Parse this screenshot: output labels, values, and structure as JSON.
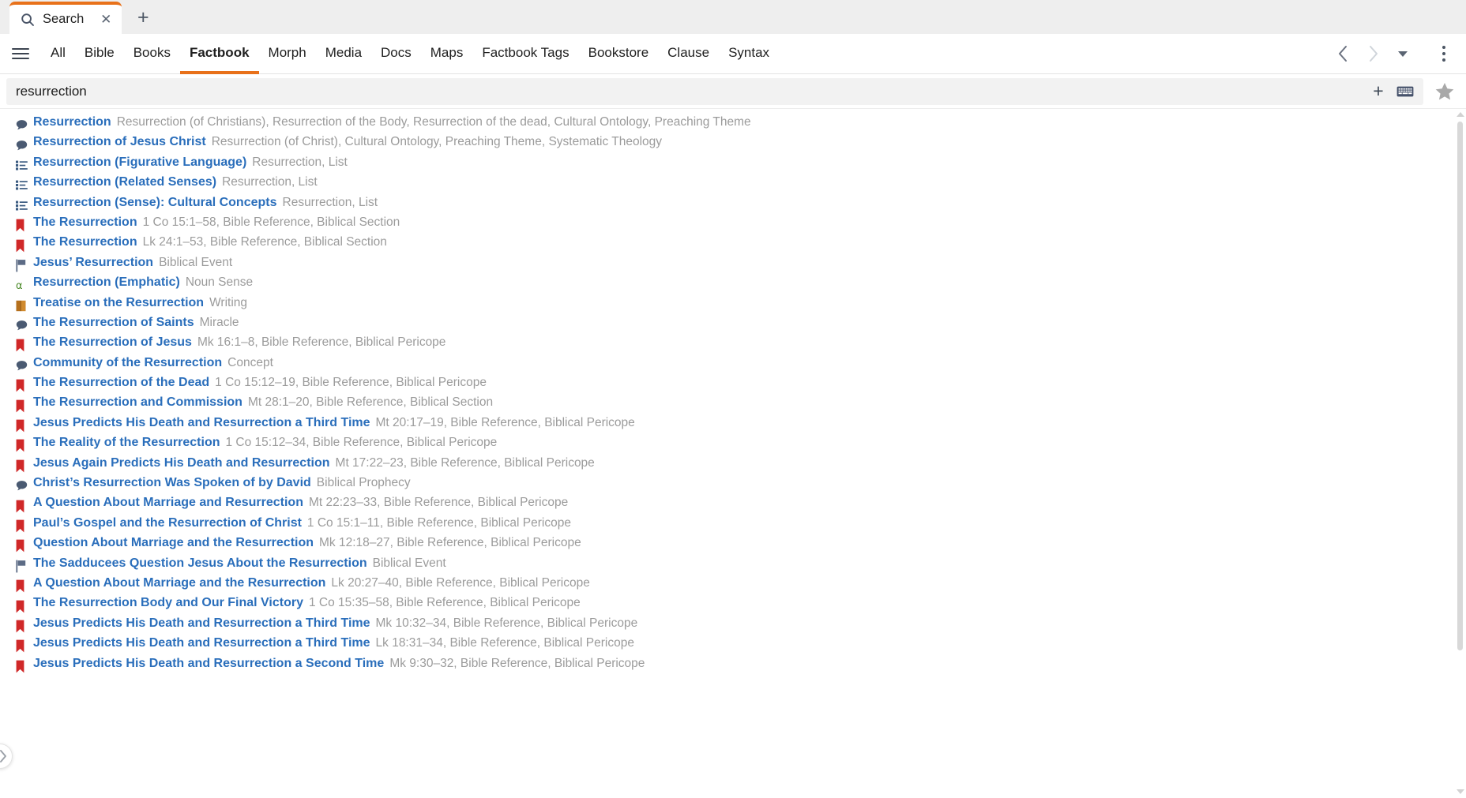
{
  "window": {
    "tab": {
      "icon": "search-icon",
      "label": "Search",
      "close_label": "✕"
    },
    "new_tab_label": "+"
  },
  "nav": {
    "menu_icon": "hamburger-icon",
    "items": [
      {
        "label": "All",
        "active": false
      },
      {
        "label": "Bible",
        "active": false
      },
      {
        "label": "Books",
        "active": false
      },
      {
        "label": "Factbook",
        "active": true
      },
      {
        "label": "Morph",
        "active": false
      },
      {
        "label": "Media",
        "active": false
      },
      {
        "label": "Docs",
        "active": false
      },
      {
        "label": "Maps",
        "active": false
      },
      {
        "label": "Factbook Tags",
        "active": false
      },
      {
        "label": "Bookstore",
        "active": false
      },
      {
        "label": "Clause",
        "active": false
      },
      {
        "label": "Syntax",
        "active": false
      }
    ],
    "back_icon": "chevron-left-icon",
    "forward_icon": "chevron-right-icon",
    "history_icon": "chevron-down-icon",
    "overflow_icon": "kebab-menu-icon"
  },
  "search": {
    "value": "resurrection",
    "placeholder": "Search",
    "add_label": "+",
    "keyboard_icon": "keyboard-icon",
    "favorite_icon": "star-icon"
  },
  "colors": {
    "accent": "#e8711a",
    "link": "#2a6ebb",
    "meta": "#9b9b9b",
    "bookmark_red": "#d02828",
    "bubble_blue": "#4a5a72",
    "flag_blue": "#5c6b85",
    "list_blue": "#3a5a80",
    "alpha_green": "#4d8b2b",
    "book_orange": "#b5701c"
  },
  "results": [
    {
      "icon": "speech-bubble-icon",
      "title": "Resurrection",
      "meta": "Resurrection (of Christians), Resurrection of the Body, Resurrection of the dead, Cultural Ontology, Preaching Theme"
    },
    {
      "icon": "speech-bubble-icon",
      "title": "Resurrection of Jesus Christ",
      "meta": "Resurrection (of Christ), Cultural Ontology, Preaching Theme, Systematic Theology"
    },
    {
      "icon": "list-icon",
      "title": "Resurrection (Figurative Language)",
      "meta": "Resurrection, List"
    },
    {
      "icon": "list-icon",
      "title": "Resurrection (Related Senses)",
      "meta": "Resurrection, List"
    },
    {
      "icon": "list-icon",
      "title": "Resurrection (Sense): Cultural Concepts",
      "meta": "Resurrection, List"
    },
    {
      "icon": "bookmark-icon",
      "title": "The Resurrection",
      "meta": "1 Co 15:1–58, Bible Reference, Biblical Section"
    },
    {
      "icon": "bookmark-icon",
      "title": "The Resurrection",
      "meta": "Lk 24:1–53, Bible Reference, Biblical Section"
    },
    {
      "icon": "flag-icon",
      "title": "Jesus’ Resurrection",
      "meta": "Biblical Event"
    },
    {
      "icon": "alpha-icon",
      "title": "Resurrection (Emphatic)",
      "meta": "Noun Sense"
    },
    {
      "icon": "book-icon",
      "title": "Treatise on the Resurrection",
      "meta": "Writing"
    },
    {
      "icon": "speech-bubble-icon",
      "title": "The Resurrection of Saints",
      "meta": "Miracle"
    },
    {
      "icon": "bookmark-icon",
      "title": "The Resurrection of Jesus",
      "meta": "Mk 16:1–8, Bible Reference, Biblical Pericope"
    },
    {
      "icon": "speech-bubble-icon",
      "title": "Community of the Resurrection",
      "meta": "Concept"
    },
    {
      "icon": "bookmark-icon",
      "title": "The Resurrection of the Dead",
      "meta": "1 Co 15:12–19, Bible Reference, Biblical Pericope"
    },
    {
      "icon": "bookmark-icon",
      "title": "The Resurrection and Commission",
      "meta": "Mt 28:1–20, Bible Reference, Biblical Section"
    },
    {
      "icon": "bookmark-icon",
      "title": "Jesus Predicts His Death and Resurrection a Third Time",
      "meta": "Mt 20:17–19, Bible Reference, Biblical Pericope"
    },
    {
      "icon": "bookmark-icon",
      "title": "The Reality of the Resurrection",
      "meta": "1 Co 15:12–34, Bible Reference, Biblical Pericope"
    },
    {
      "icon": "bookmark-icon",
      "title": "Jesus Again Predicts His Death and Resurrection",
      "meta": "Mt 17:22–23, Bible Reference, Biblical Pericope"
    },
    {
      "icon": "speech-bubble-icon",
      "title": "Christ’s Resurrection Was Spoken of by David",
      "meta": "Biblical Prophecy"
    },
    {
      "icon": "bookmark-icon",
      "title": "A Question About Marriage and Resurrection",
      "meta": "Mt 22:23–33, Bible Reference, Biblical Pericope"
    },
    {
      "icon": "bookmark-icon",
      "title": "Paul’s Gospel and the Resurrection of Christ",
      "meta": "1 Co 15:1–11, Bible Reference, Biblical Pericope"
    },
    {
      "icon": "bookmark-icon",
      "title": "Question About Marriage and the Resurrection",
      "meta": "Mk 12:18–27, Bible Reference, Biblical Pericope"
    },
    {
      "icon": "flag-icon",
      "title": "The Sadducees Question Jesus About the Resurrection",
      "meta": "Biblical Event"
    },
    {
      "icon": "bookmark-icon",
      "title": "A Question About Marriage and the Resurrection",
      "meta": "Lk 20:27–40, Bible Reference, Biblical Pericope"
    },
    {
      "icon": "bookmark-icon",
      "title": "The Resurrection Body and Our Final Victory",
      "meta": "1 Co 15:35–58, Bible Reference, Biblical Pericope"
    },
    {
      "icon": "bookmark-icon",
      "title": "Jesus Predicts His Death and Resurrection a Third Time",
      "meta": "Mk 10:32–34, Bible Reference, Biblical Pericope"
    },
    {
      "icon": "bookmark-icon",
      "title": "Jesus Predicts His Death and Resurrection a Third Time",
      "meta": "Lk 18:31–34, Bible Reference, Biblical Pericope"
    },
    {
      "icon": "bookmark-icon",
      "title": "Jesus Predicts His Death and Resurrection a Second Time",
      "meta": "Mk 9:30–32, Bible Reference, Biblical Pericope"
    }
  ],
  "panel_expander": {
    "icon": "chevron-right-icon"
  },
  "scrollbar": {
    "up_icon": "caret-up-icon",
    "down_icon": "caret-down-icon"
  }
}
